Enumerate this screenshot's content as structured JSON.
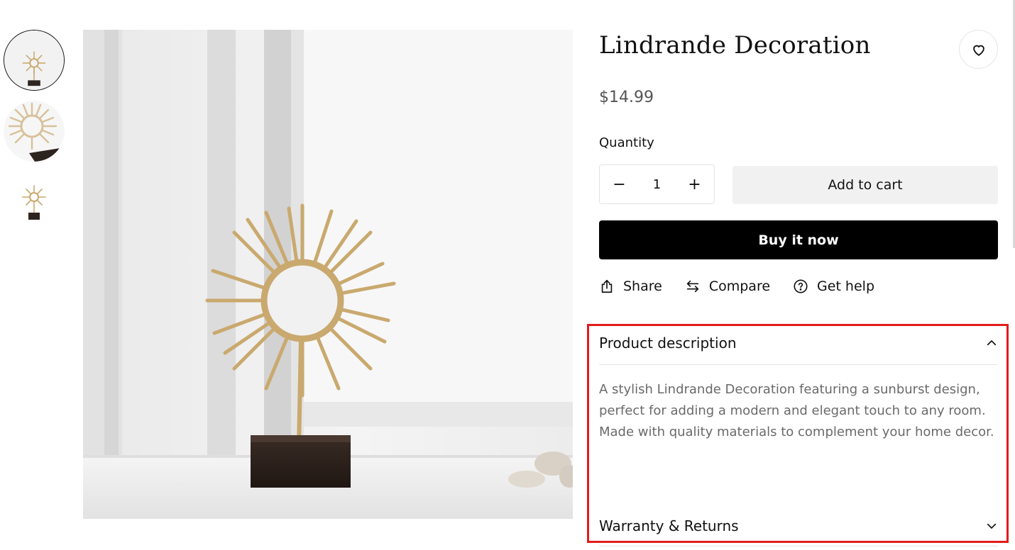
{
  "product": {
    "title": "Lindrande Decoration",
    "price": "$14.99",
    "quantity_label": "Quantity",
    "quantity_value": "1",
    "decrement": "−",
    "increment": "+",
    "add_to_cart": "Add to cart",
    "buy_now": "Buy it now"
  },
  "actions": {
    "share": "Share",
    "compare": "Compare",
    "get_help": "Get help"
  },
  "accordion": {
    "description_title": "Product description",
    "description_text": "A stylish Lindrande Decoration featuring a sunburst design, perfect for adding a modern and elegant touch to any room. Made with quality materials to complement your home decor.",
    "warranty_title": "Warranty & Returns"
  },
  "thumbnails": [
    {
      "active": true
    },
    {
      "active": false
    },
    {
      "active": false
    }
  ],
  "colors": {
    "highlight": "#e31b1b",
    "buy_now_bg": "#000000",
    "add_cart_bg": "#f1f1f1",
    "gold": "#c9a96e"
  },
  "icons": [
    "heart-icon",
    "share-icon",
    "compare-icon",
    "help-icon",
    "chevron-up-icon",
    "chevron-down-icon"
  ]
}
